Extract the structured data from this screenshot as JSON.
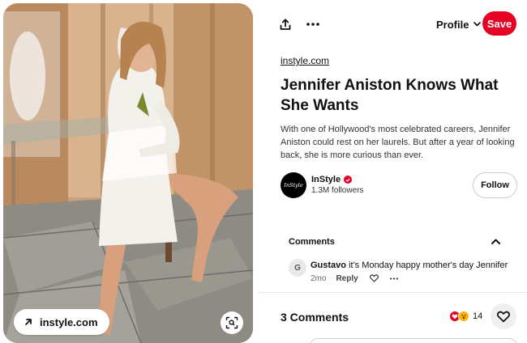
{
  "image": {
    "source_label": "instyle.com",
    "icons": {
      "source": "arrow-up-right-icon",
      "lens": "visual-search-icon"
    }
  },
  "toolbar": {
    "profile_label": "Profile",
    "save_label": "Save",
    "icons": {
      "share": "share-icon",
      "more": "more-icon",
      "profile": "chevron-down-icon"
    }
  },
  "pin": {
    "source_link": "instyle.com",
    "title": "Jennifer Aniston Knows What She Wants",
    "description": "With one of Hollywood's most celebrated careers, Jennifer Aniston could rest on her laurels. But after a year of looking back, she is more curious than ever."
  },
  "creator": {
    "avatar_text": "InStyle",
    "name": "InStyle",
    "followers": "1.3M followers",
    "follow_label": "Follow"
  },
  "comments": {
    "header": "Comments",
    "items": [
      {
        "avatar_initial": "G",
        "author": "Gustavo",
        "text": "it's Monday happy mother's day Jennifer",
        "time": "2mo",
        "reply_label": "Reply"
      }
    ]
  },
  "footer": {
    "count_label": "3 Comments",
    "reactions_count": "14"
  },
  "colors": {
    "brand": "#e60023",
    "text": "#111111",
    "muted": "#666666"
  }
}
